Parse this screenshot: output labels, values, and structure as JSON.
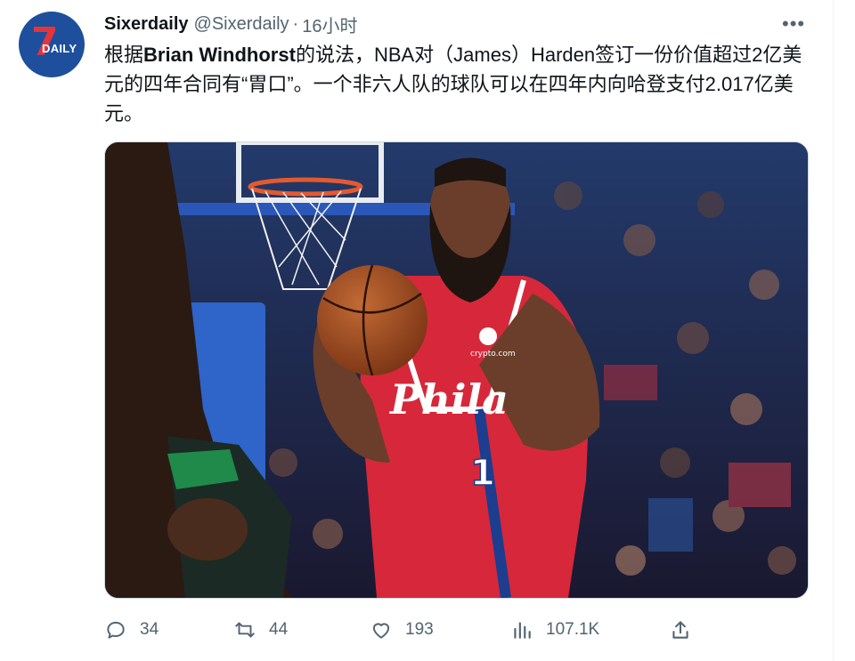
{
  "tweet": {
    "author_name": "Sixerdaily",
    "author_handle": "@Sixerdaily",
    "separator": "·",
    "time": "16小时",
    "avatar_text_number": "7",
    "avatar_text_word": "DAILY",
    "text_part1": "根据",
    "text_bold": "Brian Windhorst",
    "text_part2": "的说法，NBA对（James）Harden签订一份价值超过2亿美元的四年合同有“胃口”。一个非六人队的球队可以在四年内向哈登支付2.017亿美元。"
  },
  "media": {
    "jersey_team": "Phila",
    "jersey_number": "1",
    "sponsor": "crypto.com"
  },
  "actions": {
    "replies": "34",
    "retweets": "44",
    "likes": "193",
    "views": "107.1K"
  },
  "colors": {
    "text": "#0f1419",
    "muted": "#536471",
    "jersey_red": "#d6283a",
    "jersey_blue": "#1d3d8f",
    "avatar_bg": "#1d4f9c"
  },
  "icons": [
    "reply-icon",
    "retweet-icon",
    "like-icon",
    "views-icon",
    "share-icon",
    "more-icon"
  ]
}
